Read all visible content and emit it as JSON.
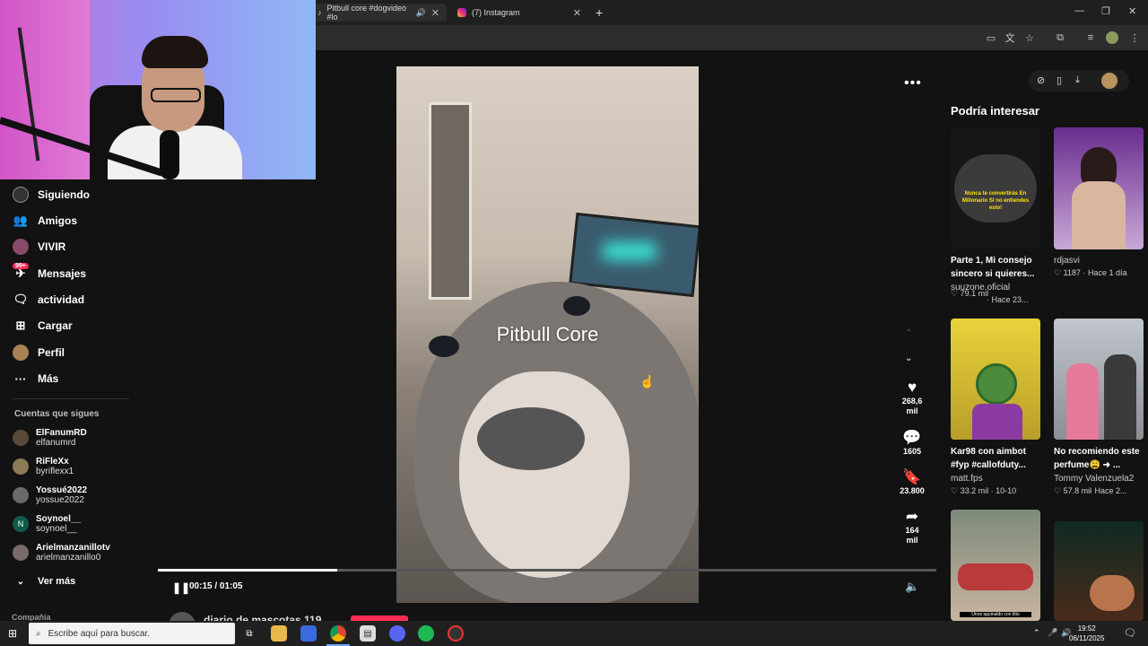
{
  "browser": {
    "tabs": [
      {
        "label": "Pitbull core #dogvideo #lo"
      },
      {
        "label": "(7) Instagram"
      }
    ],
    "new_tab": "+"
  },
  "sidebar": {
    "items": [
      {
        "label": "Siguiendo",
        "icon": "following-icon"
      },
      {
        "label": "Amigos",
        "icon": "friends-icon"
      },
      {
        "label": "VIVIR",
        "icon": "live-icon"
      },
      {
        "label": "Mensajes",
        "icon": "messages-icon"
      },
      {
        "label": "actividad",
        "icon": "activity-icon"
      },
      {
        "label": "Cargar",
        "icon": "upload-icon"
      },
      {
        "label": "Perfil",
        "icon": "profile-icon"
      },
      {
        "label": "Más",
        "icon": "more-icon"
      }
    ],
    "messages_badge": "99+",
    "following_title": "Cuentas que sigues",
    "accounts": [
      {
        "name": "ElFanumRD",
        "handle": "elfanumrd"
      },
      {
        "name": "RiFleXx",
        "handle": "byriflexx1"
      },
      {
        "name": "Yossué2022",
        "handle": "yossue2022"
      },
      {
        "name": "Soynoel__",
        "handle": "soynoel__",
        "initial": "N"
      },
      {
        "name": "Arielmanzanillotv",
        "handle": "arielmanzanillo0"
      }
    ],
    "see_more": "Ver más",
    "footer": "Compañía"
  },
  "video": {
    "title_overlay": "Pitbull Core",
    "time": "00:15 / 01:05",
    "progress": 0.23,
    "author_partial": "diario de mascotas 119"
  },
  "actions": {
    "likes": [
      "268,6",
      "mil"
    ],
    "comments": "1605",
    "saves": "23.800",
    "shares": [
      "164",
      "mil"
    ]
  },
  "right_panel": {
    "title": "Podría interesar",
    "cards": [
      {
        "title": "Parte 1, Mi consejo sincero si quieres...",
        "author": "suuzone.oficial",
        "likes": "79.1 mil",
        "date": "Hace 23...",
        "thumb_text": "Nunca te convertirás En Millonario Si no entiendes esto!"
      },
      {
        "title": "",
        "author": "rdjasvi",
        "likes": "1187",
        "date": "Hace 1 día"
      },
      {
        "title": "Kar98 con aimbot #fyp #callofduty...",
        "author": "matt.fps",
        "likes": "33.2 mil",
        "date": "10-10"
      },
      {
        "title": "No recomiendo este perfume😩 ➜ ...",
        "author": "Tommy Valenzuela2",
        "likes": "57.8 mil",
        "date": "Hace 2..."
      },
      {
        "title": "",
        "author": "",
        "likes": "",
        "date": "",
        "thumb_text": "Unos aguinaldo con titio"
      },
      {
        "title": "",
        "author": "",
        "likes": "",
        "date": ""
      }
    ]
  },
  "taskbar": {
    "search_placeholder": "Escribe aquí para buscar.",
    "time": "19:52",
    "date": "06/11/2025"
  }
}
